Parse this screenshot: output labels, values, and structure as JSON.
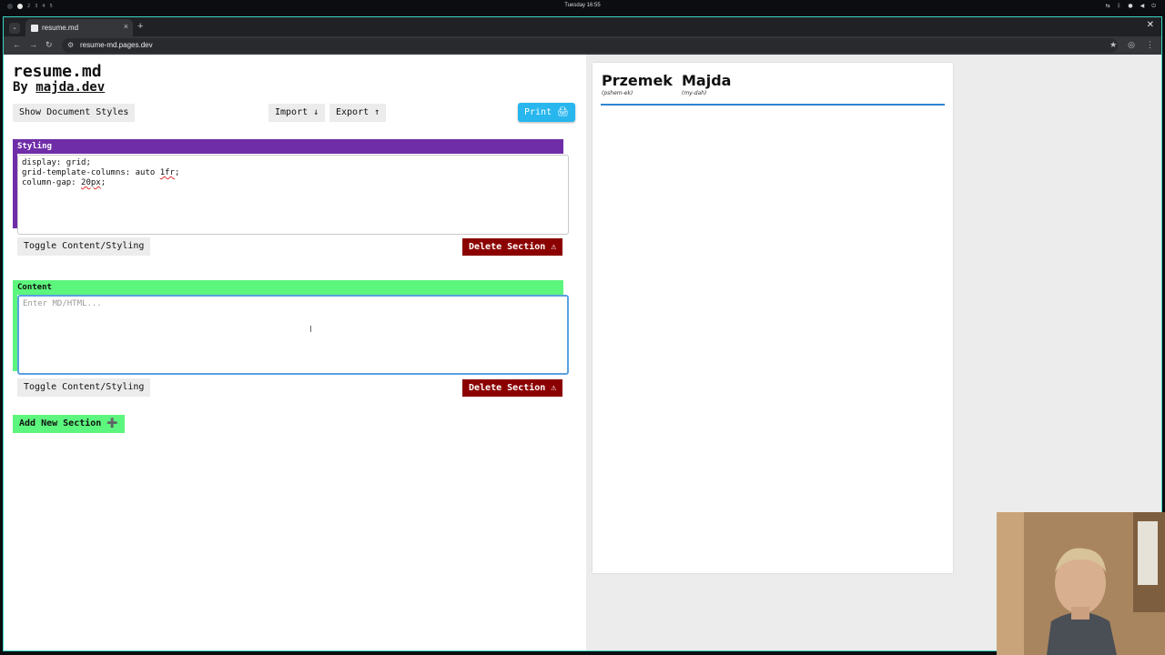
{
  "os": {
    "workspaces": [
      "1",
      "2",
      "3",
      "4",
      "5"
    ],
    "clock": "Tuesday 16:55"
  },
  "browser": {
    "tab_title": "resume.md",
    "url": "resume-md.pages.dev"
  },
  "editor": {
    "title": "resume.md",
    "byline_prefix": "By ",
    "byline_link": "majda.dev",
    "show_styles_label": "Show Document Styles",
    "import_label": "Import ↓",
    "export_label": "Export ↑",
    "print_label": "Print 🖨",
    "sections": [
      {
        "header": "Styling",
        "color": "#6f2da8",
        "lines": [
          "display: grid;",
          "grid-template-columns: auto 1fr;",
          "column-gap: 20px;"
        ]
      },
      {
        "header": "Content",
        "color": "#5cf57d",
        "placeholder": "Enter MD/HTML..."
      }
    ],
    "toggle_label": "Toggle Content/Styling",
    "delete_label": "Delete Section ⚠",
    "add_label": "Add New Section ➕"
  },
  "preview": {
    "first_name": "Przemek",
    "first_pron": "(pshem-ek)",
    "last_name": "Majda",
    "last_pron": "(my-dah)",
    "rule_color": "#2f86d0"
  }
}
